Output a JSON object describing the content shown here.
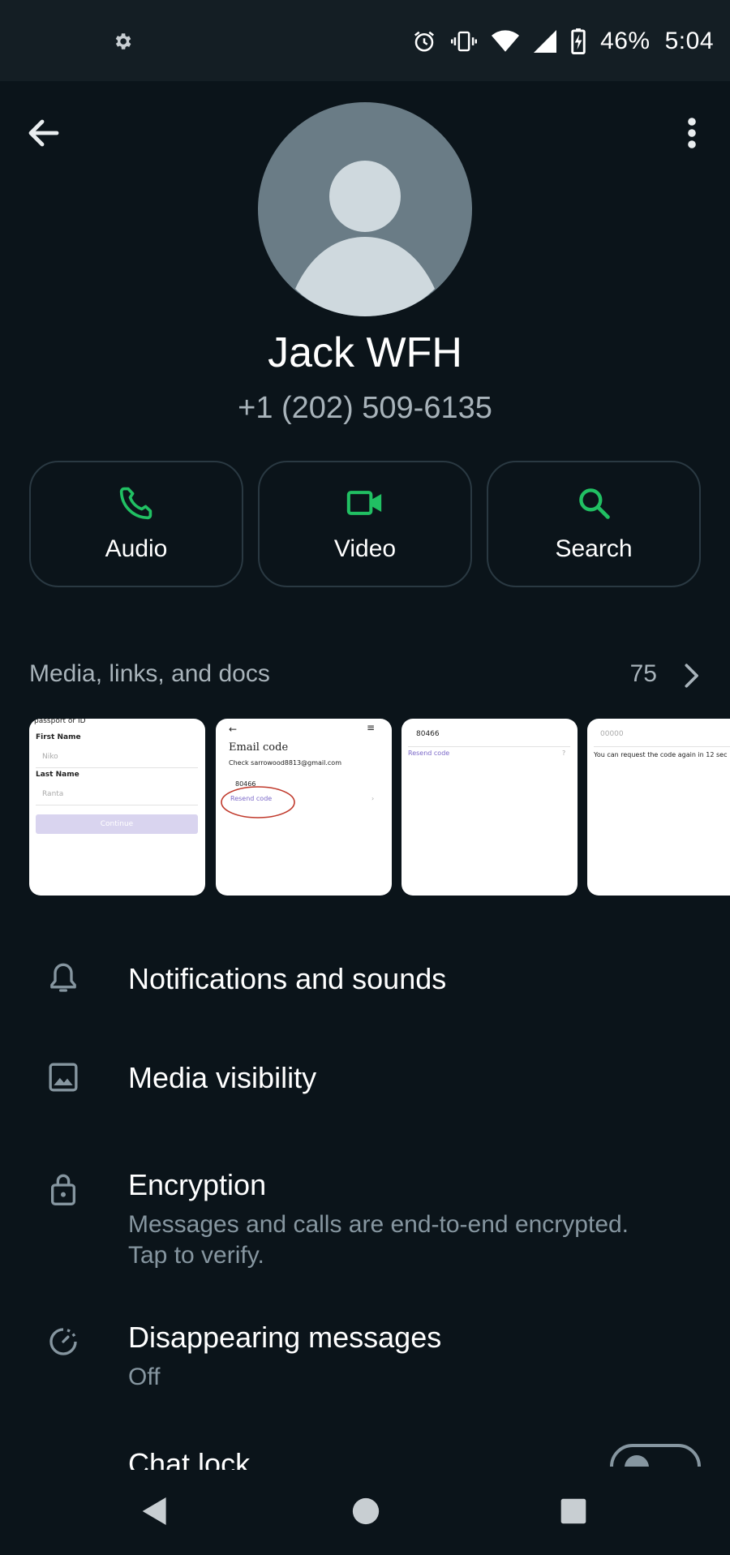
{
  "status_bar": {
    "battery_percent": "46%",
    "time": "5:04",
    "icons": [
      "settings-gear-icon",
      "alarm-icon",
      "vibrate-icon",
      "wifi-icon",
      "cellular-signal-icon",
      "battery-charging-icon"
    ]
  },
  "header": {
    "back_icon": "back-arrow-icon",
    "menu_icon": "more-vert-icon"
  },
  "contact": {
    "name": "Jack WFH",
    "phone": "+1 (202) 509-6135"
  },
  "actions": [
    {
      "label": "Audio",
      "icon": "phone-icon"
    },
    {
      "label": "Video",
      "icon": "video-camera-icon"
    },
    {
      "label": "Search",
      "icon": "search-icon"
    }
  ],
  "accent_color": "#21c063",
  "media": {
    "title": "Media, links, and docs",
    "count": "75",
    "thumbs": [
      {
        "header": "passport or ID",
        "first_name_label": "First Name",
        "first_name_value": "Niko",
        "last_name_label": "Last Name",
        "last_name_value": "Ranta",
        "button": "Continue"
      },
      {
        "title": "Email code",
        "text": "Check sarrowood8813@gmail.com",
        "code": "80466",
        "link": "Resend code"
      },
      {
        "code": "80466",
        "link": "Resend code"
      },
      {
        "placeholder": "00000",
        "text": "You can request the code again in 12 sec"
      }
    ]
  },
  "settings": {
    "notifications": {
      "title": "Notifications and sounds",
      "icon": "bell-icon"
    },
    "media_visibility": {
      "title": "Media visibility",
      "icon": "image-icon"
    },
    "encryption": {
      "title": "Encryption",
      "line1": "Messages and calls are end-to-end encrypted.",
      "line2": "Tap to verify.",
      "icon": "lock-icon"
    },
    "disappearing": {
      "title": "Disappearing messages",
      "value": "Off",
      "icon": "timer-icon"
    },
    "chat_lock": {
      "title": "Chat lock",
      "enabled": false
    }
  },
  "nav_bar": [
    "nav-back-icon",
    "nav-home-icon",
    "nav-recents-icon"
  ]
}
